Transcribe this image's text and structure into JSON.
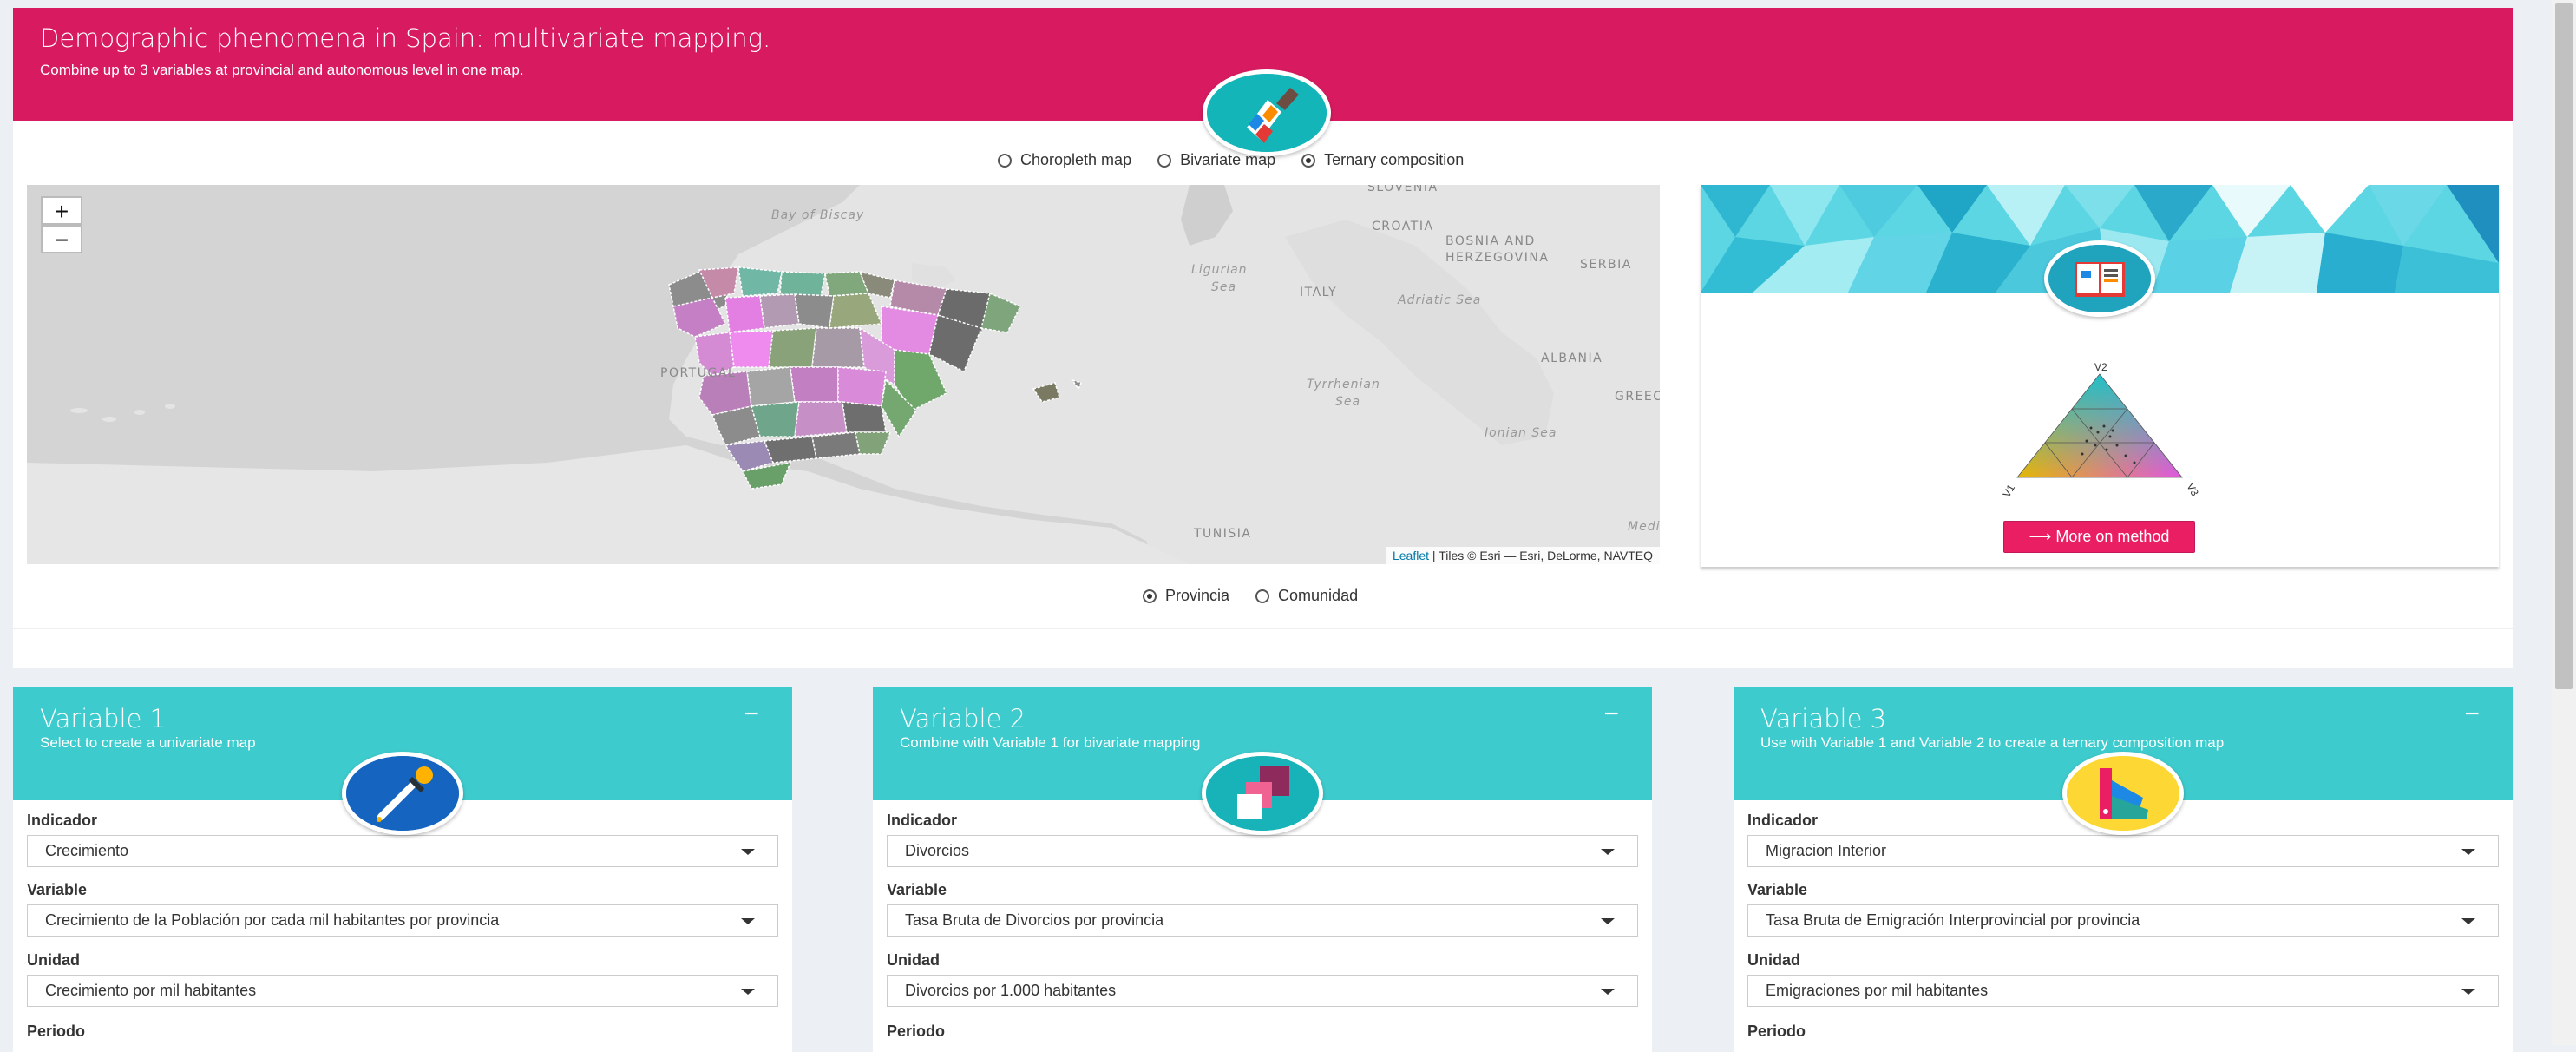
{
  "header": {
    "title": "Demographic phenomena in Spain: multivariate mapping.",
    "subtitle": "Combine up to 3 variables at provincial and autonomous level in one map."
  },
  "map_type": {
    "options": [
      "Choropleth map",
      "Bivariate map",
      "Ternary composition"
    ],
    "selected": "Ternary composition"
  },
  "map": {
    "zoom_in": "+",
    "zoom_out": "−",
    "labels": {
      "slovenia": "SLOVENIA",
      "croatia": "CROATIA",
      "bosnia1": "BOSNIA AND",
      "bosnia2": "HERZEGOVINA",
      "serbia": "SERBIA",
      "italy": "ITALY",
      "albania": "ALBANIA",
      "greece": "GREEC",
      "portugal": "PORTUGAL",
      "tunisia": "TUNISIA",
      "biscay": "Bay of Biscay",
      "ligurian1": "Ligurian",
      "ligurian2": "Sea",
      "adriatic": "Adriatic Sea",
      "tyrrhenian1": "Tyrrhenian",
      "tyrrhenian2": "Sea",
      "ionian": "Ionian Sea",
      "medit": "Medit"
    },
    "attribution_link": "Leaflet",
    "attribution_text": " | Tiles © Esri — Esri, DeLorme, NAVTEQ"
  },
  "level": {
    "options": [
      "Provincia",
      "Comunidad"
    ],
    "selected": "Provincia"
  },
  "side": {
    "ternary_labels": {
      "v1": "V1",
      "v2": "V2",
      "v3": "V3"
    },
    "more_button": "More on method",
    "more_icon": "arrow-right-icon"
  },
  "variables": [
    {
      "title": "Variable 1",
      "subtitle": "Select to create a univariate map",
      "collapse": "−",
      "icon": "eyedropper-icon",
      "fields": {
        "indicador_label": "Indicador",
        "indicador": "Crecimiento",
        "variable_label": "Variable",
        "variable": "Crecimiento de la Población por cada mil habitantes por provincia",
        "unidad_label": "Unidad",
        "unidad": "Crecimiento por mil habitantes",
        "periodo_label": "Periodo"
      }
    },
    {
      "title": "Variable 2",
      "subtitle": "Combine with Variable 1 for bivariate mapping",
      "collapse": "−",
      "icon": "layers-icon",
      "fields": {
        "indicador_label": "Indicador",
        "indicador": "Divorcios",
        "variable_label": "Variable",
        "variable": "Tasa Bruta de Divorcios por provincia",
        "unidad_label": "Unidad",
        "unidad": "Divorcios por 1.000 habitantes",
        "periodo_label": "Periodo"
      }
    },
    {
      "title": "Variable 3",
      "subtitle": "Use with Variable 1 and Variable 2 to create a ternary composition map",
      "collapse": "−",
      "icon": "color-swatch-icon",
      "fields": {
        "indicador_label": "Indicador",
        "indicador": "Migracion Interior",
        "variable_label": "Variable",
        "variable": "Tasa Bruta de Emigración Interprovincial por provincia",
        "unidad_label": "Unidad",
        "unidad": "Emigraciones por mil habitantes",
        "periodo_label": "Periodo"
      }
    }
  ],
  "colors": {
    "header": "#d81b60",
    "variable_header": "#3ecbcd",
    "button": "#e91e63",
    "map_background": "#d4d4d4"
  }
}
